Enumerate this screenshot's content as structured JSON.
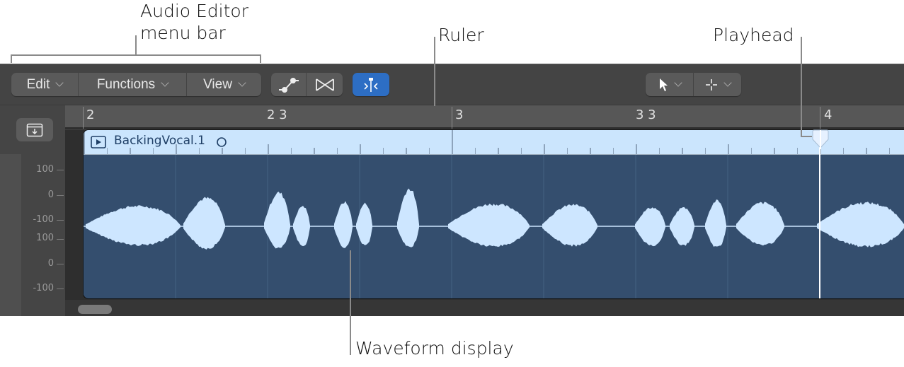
{
  "callouts": {
    "audio_editor_menu_bar": "Audio Editor\nmenu bar",
    "audio_editor_line1": "Audio Editor",
    "audio_editor_line2": "menu bar",
    "ruler": "Ruler",
    "playhead": "Playhead",
    "waveform_display": "Waveform display"
  },
  "toolbar": {
    "menus": [
      {
        "label": "Edit"
      },
      {
        "label": "Functions"
      },
      {
        "label": "View"
      }
    ],
    "buttons": [
      {
        "icon": "curve-tool-icon",
        "active": false
      },
      {
        "icon": "crossfade-icon",
        "active": false
      },
      {
        "icon": "catch-playhead-icon",
        "active": true
      }
    ],
    "tools": [
      {
        "icon": "pointer-tool-icon"
      },
      {
        "icon": "marquee-tool-icon"
      }
    ],
    "accent_color": "#2d6ec4"
  },
  "left_panel": {
    "download_button_icon": "download-icon",
    "channels": [
      {
        "labels": [
          "100",
          "0",
          "-100"
        ]
      },
      {
        "labels": [
          "100",
          "0",
          "-100"
        ]
      }
    ]
  },
  "ruler": {
    "marks": [
      "2",
      "2 3",
      "3",
      "3 3",
      "4"
    ]
  },
  "region": {
    "name": "BackingVocal.1",
    "play_icon": "play-icon",
    "loop_icon": "circle-icon",
    "header_color": "#cbe5fd",
    "body_color": "#344e6e",
    "waveform_color": "#cde6ff"
  },
  "playhead": {
    "position_label": "4"
  }
}
